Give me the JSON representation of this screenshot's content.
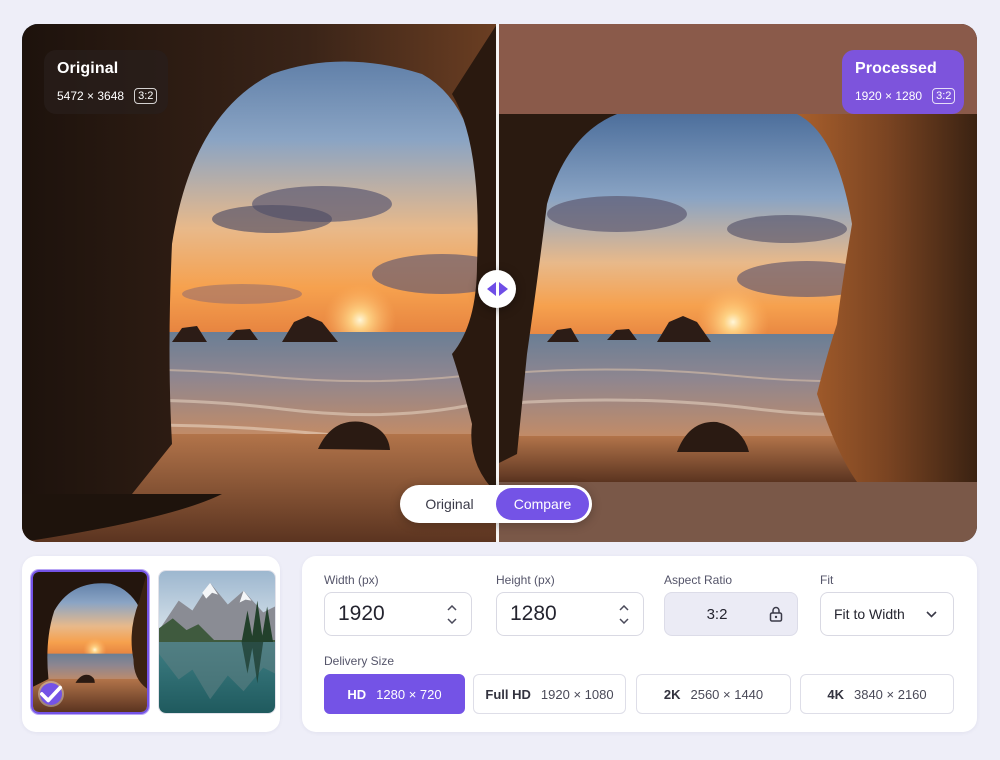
{
  "preview": {
    "original": {
      "title": "Original",
      "dimensions": "5472 × 3648",
      "ratio": "3:2"
    },
    "processed": {
      "title": "Processed",
      "dimensions": "1920 × 1280",
      "ratio": "3:2"
    },
    "toggle": {
      "original_label": "Original",
      "compare_label": "Compare",
      "active": "Compare"
    },
    "divider_icon": "left-right-arrows-icon"
  },
  "thumbnails": [
    {
      "name": "sea-cave-sunset",
      "selected": true,
      "icon": "checkmark-icon"
    },
    {
      "name": "mountain-lake",
      "selected": false
    }
  ],
  "settings": {
    "width": {
      "label": "Width (px)",
      "value": "1920"
    },
    "height": {
      "label": "Height (px)",
      "value": "1280"
    },
    "aspect": {
      "label": "Aspect Ratio",
      "value": "3:2",
      "icon": "lock-icon"
    },
    "fit": {
      "label": "Fit",
      "value": "Fit to Width",
      "icon": "chevron-down-icon"
    },
    "delivery": {
      "label": "Delivery Size",
      "options": [
        {
          "name": "HD",
          "res": "1280 × 720",
          "selected": true
        },
        {
          "name": "Full HD",
          "res": "1920 × 1080",
          "selected": false
        },
        {
          "name": "2K",
          "res": "2560 × 1440",
          "selected": false
        },
        {
          "name": "4K",
          "res": "3840 × 2160",
          "selected": false
        }
      ]
    }
  },
  "colors": {
    "accent": "#7453e6",
    "background": "#eeeef8",
    "panel": "#ffffff"
  }
}
